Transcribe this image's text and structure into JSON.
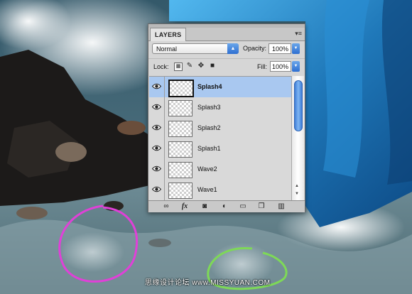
{
  "panel": {
    "tab_label": "LAYERS",
    "menu_glyph": "▾≡",
    "blend_mode": "Normal",
    "opacity_label": "Opacity:",
    "opacity_value": "100%",
    "lock_label": "Lock:",
    "fill_label": "Fill:",
    "fill_value": "100%",
    "layers": [
      {
        "name": "Splash4",
        "selected": true
      },
      {
        "name": "Splash3",
        "selected": false
      },
      {
        "name": "Splash2",
        "selected": false
      },
      {
        "name": "Splash1",
        "selected": false
      },
      {
        "name": "Wave2",
        "selected": false
      },
      {
        "name": "Wave1",
        "selected": false
      }
    ],
    "footer_icons": [
      "link-icon",
      "fx-icon",
      "mask-icon",
      "adjustment-icon",
      "folder-icon",
      "new-layer-icon",
      "trash-icon"
    ],
    "fx_label": "fx"
  },
  "annotations": {
    "green": "#7ed957",
    "magenta": "#e040d8"
  },
  "watermark": "思缘设计论坛 www.MISSYUAN.COM"
}
